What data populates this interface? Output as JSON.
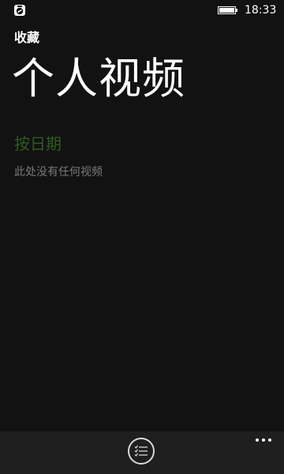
{
  "status_bar": {
    "time": "18:33",
    "app_icon": "app-notification-icon",
    "battery_icon": "battery-icon"
  },
  "header": {
    "app_title": "收藏",
    "page_title": "个人视频"
  },
  "content": {
    "section_header": "按日期",
    "empty_message": "此处没有任何视频"
  },
  "app_bar": {
    "primary_button_icon": "select-list-icon",
    "more_icon": "more-options-icon"
  },
  "colors": {
    "background": "#121212",
    "accent": "#2f5a1e",
    "secondary_text": "#7a7a7a",
    "app_bar": "#1f1f1f"
  }
}
